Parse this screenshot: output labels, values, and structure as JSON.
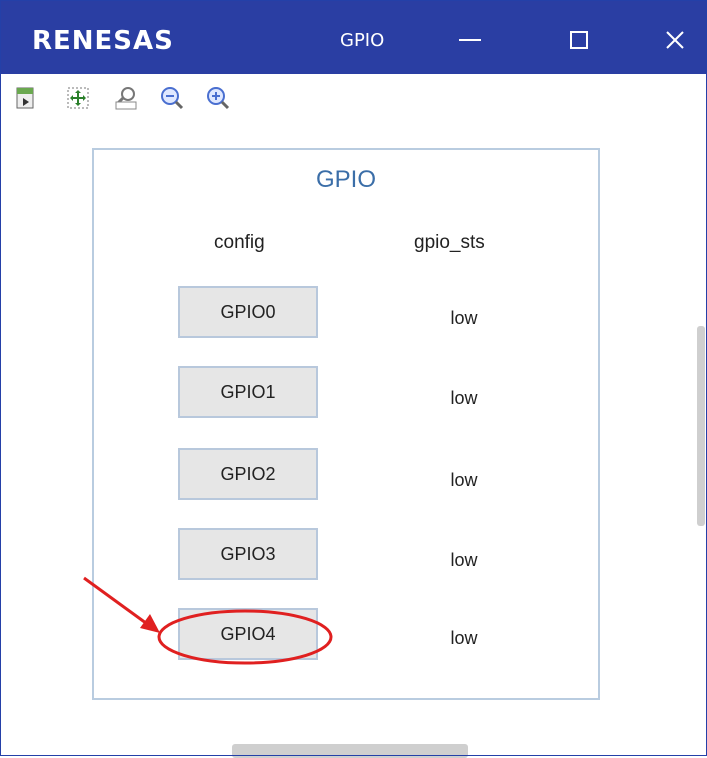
{
  "window": {
    "logo_text": "RENESAS",
    "title": "GPIO",
    "minimize_label": "—",
    "maximize_label": "☐",
    "close_label": "✕",
    "titlebar_color": "#2a3ea3"
  },
  "toolbar": {
    "icons": [
      "export-icon",
      "fit-to-window-icon",
      "zoom-100-icon",
      "zoom-out-icon",
      "zoom-in-icon"
    ]
  },
  "panel": {
    "title": "GPIO",
    "columns": {
      "config": "config",
      "status": "gpio_sts"
    },
    "rows": [
      {
        "button": "GPIO0",
        "status": "low"
      },
      {
        "button": "GPIO1",
        "status": "low"
      },
      {
        "button": "GPIO2",
        "status": "low"
      },
      {
        "button": "GPIO3",
        "status": "low"
      },
      {
        "button": "GPIO4",
        "status": "low"
      }
    ]
  },
  "annotation": {
    "color": "#e02020",
    "target": "GPIO4"
  }
}
